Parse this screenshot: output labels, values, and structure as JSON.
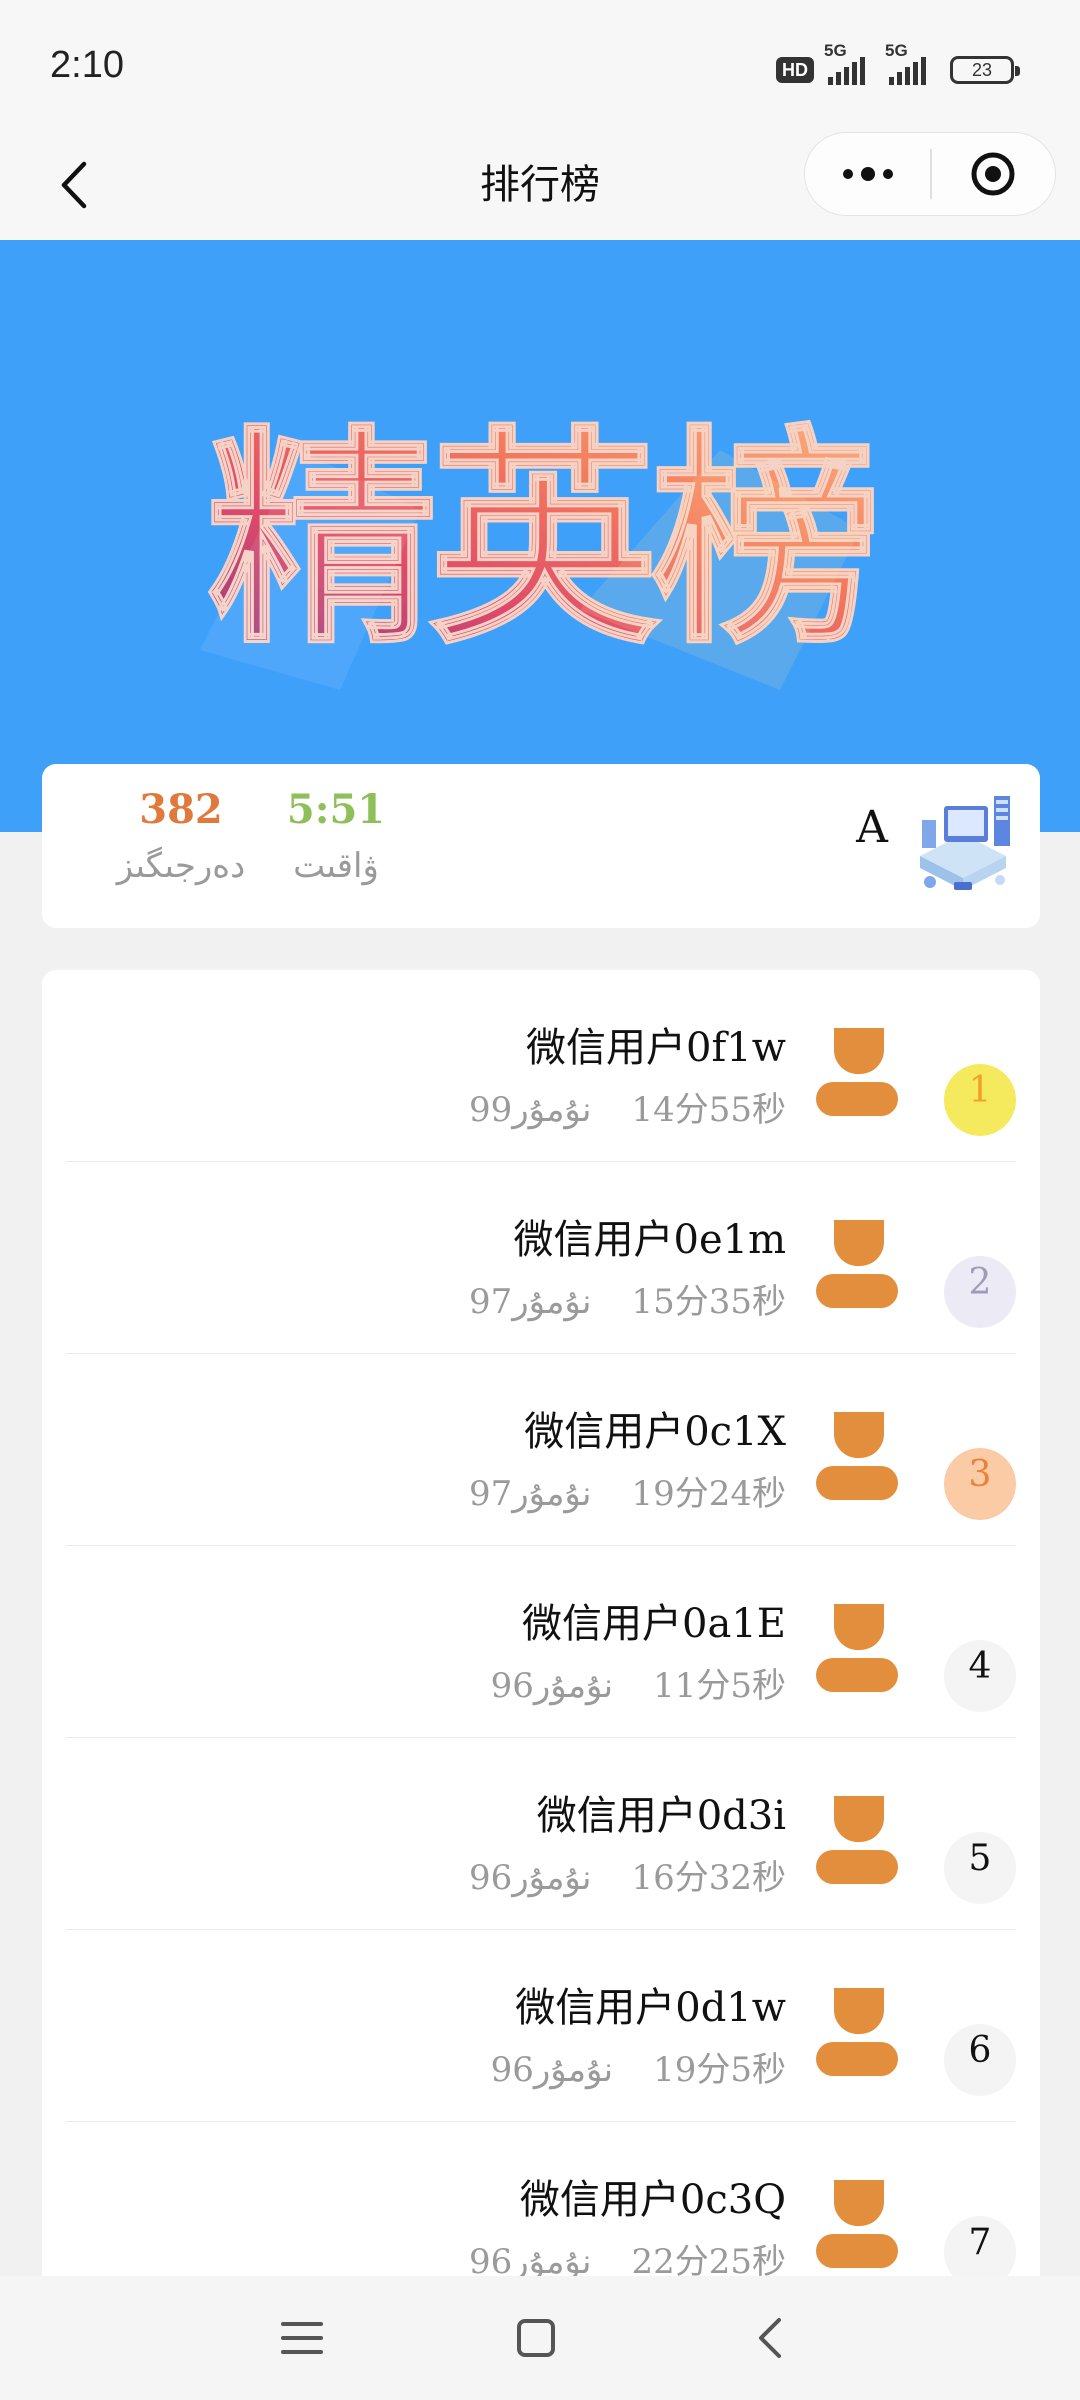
{
  "status": {
    "time": "2:10",
    "hd": "HD",
    "net1": "5G",
    "net2": "5G",
    "battery": "23"
  },
  "nav": {
    "title": "排行榜"
  },
  "banner": {
    "art_text": "精英榜"
  },
  "me": {
    "score": "382",
    "score_label": "دەرجىگىز",
    "time": "5:51",
    "time_label": "ۋاقىت",
    "name": "A"
  },
  "ranking": [
    {
      "rank": "1",
      "name": "微信用户0f1w",
      "time": "14分55秒",
      "score": "نۇمۇر99"
    },
    {
      "rank": "2",
      "name": "微信用户0e1m",
      "time": "15分35秒",
      "score": "نۇمۇر97"
    },
    {
      "rank": "3",
      "name": "微信用户0c1X",
      "time": "19分24秒",
      "score": "نۇمۇر97"
    },
    {
      "rank": "4",
      "name": "微信用户0a1E",
      "time": "11分5秒",
      "score": "نۇمۇر96"
    },
    {
      "rank": "5",
      "name": "微信用户0d3i",
      "time": "16分32秒",
      "score": "نۇمۇر96"
    },
    {
      "rank": "6",
      "name": "微信用户0d1w",
      "time": "19分5秒",
      "score": "نۇمۇر96"
    },
    {
      "rank": "7",
      "name": "微信用户0c3Q",
      "time": "22分25秒",
      "score": "نۇمۇر96"
    }
  ],
  "colors": {
    "banner": "#3fa0fa",
    "score": "#e07a3c",
    "time": "#8fbf5b",
    "avatar": "#e38e3c"
  }
}
